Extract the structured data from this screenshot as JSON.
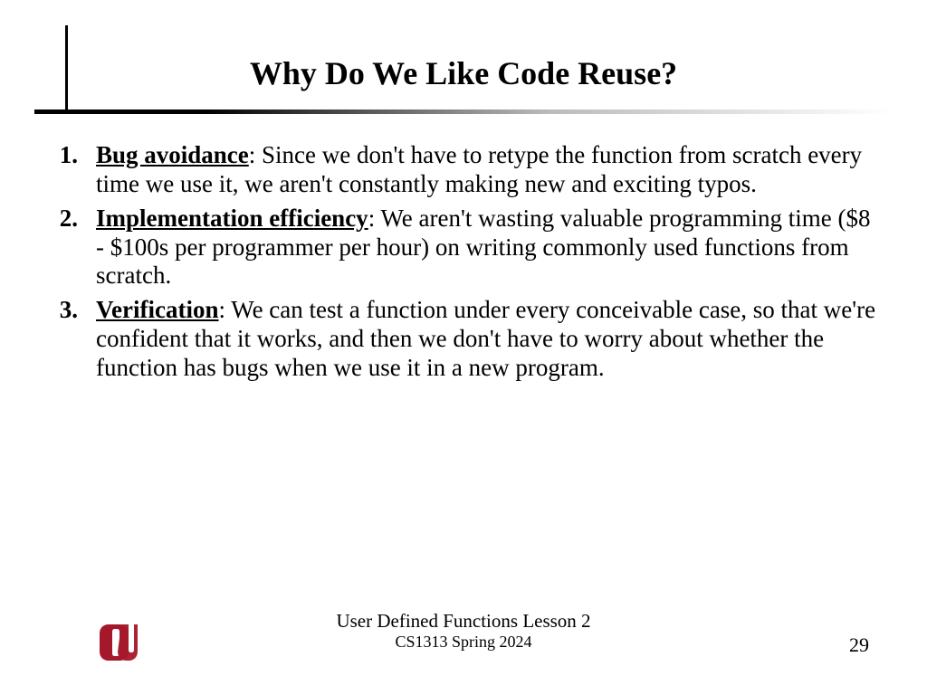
{
  "title": "Why Do We Like Code Reuse?",
  "items": [
    {
      "num": "1.",
      "term": "Bug avoidance",
      "rest": ": Since we don't have to retype the function from scratch every time we use it, we aren't constantly making new and exciting typos."
    },
    {
      "num": "2.",
      "term": "Implementation efficiency",
      "rest": ": We aren't wasting valuable programming time ($8 - $100s per programmer per hour) on writing commonly used functions from scratch."
    },
    {
      "num": "3.",
      "term": "Verification",
      "rest": ": We can test a function under every conceivable case, so that we're confident that it works, and then we don't have to worry about whether the function has bugs when we use it in a new program."
    }
  ],
  "footer": {
    "title": "User Defined Functions Lesson 2",
    "subtitle": "CS1313 Spring 2024",
    "page": "29"
  },
  "logo": {
    "name": "ou-logo",
    "color": "#a5182b"
  }
}
